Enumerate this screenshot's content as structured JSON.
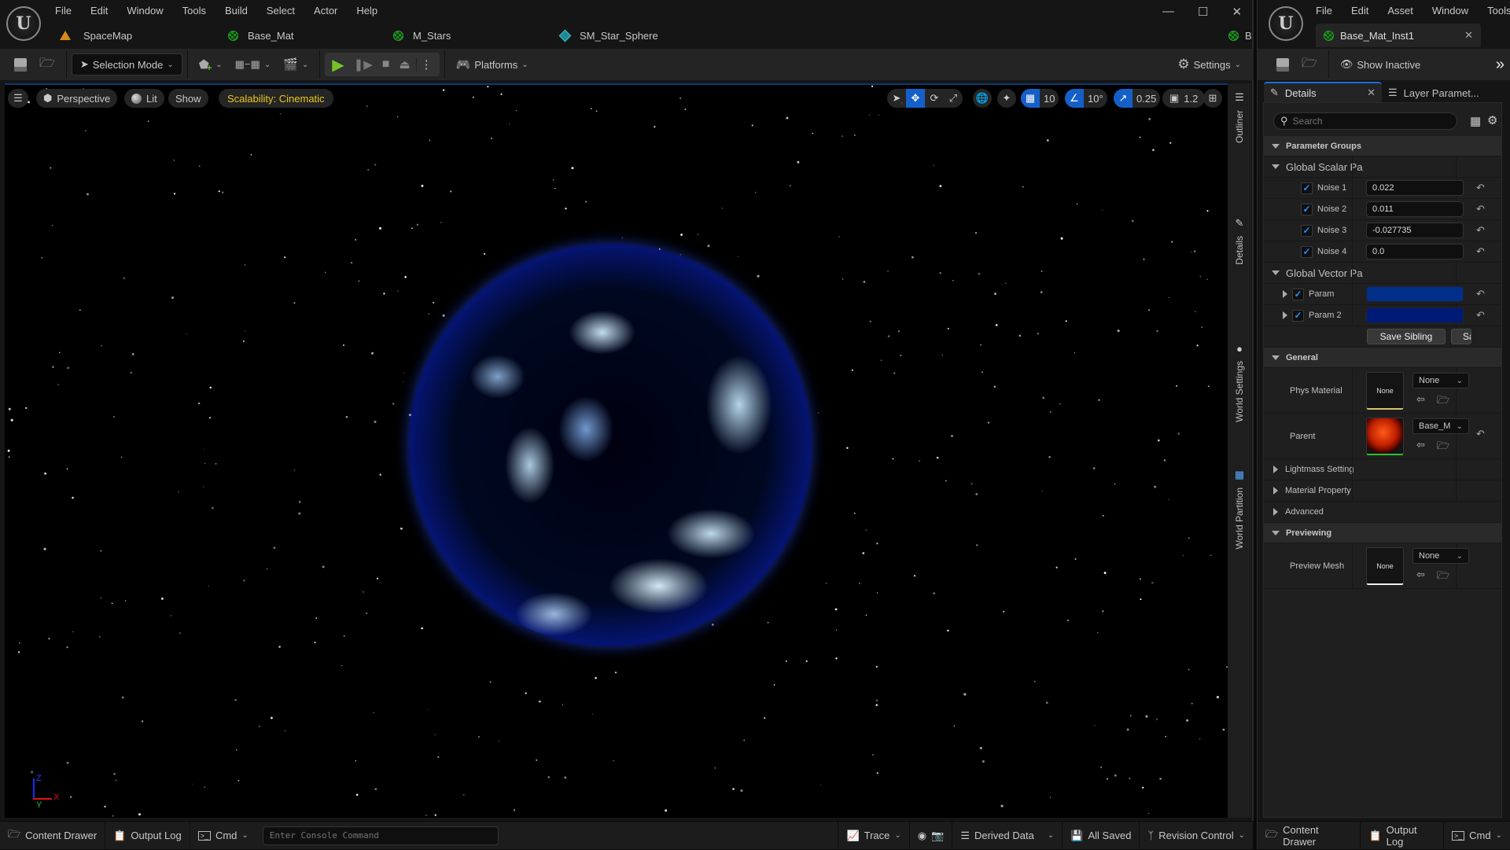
{
  "main_window": {
    "menu": [
      "File",
      "Edit",
      "Window",
      "Tools",
      "Build",
      "Select",
      "Actor",
      "Help"
    ],
    "tabs": [
      {
        "label": "SpaceMap",
        "icon": "level-icon"
      },
      {
        "label": "Base_Mat",
        "icon": "material-icon"
      },
      {
        "label": "M_Stars",
        "icon": "material-icon"
      },
      {
        "label": "SM_Star_Sphere",
        "icon": "static-mesh-icon"
      }
    ],
    "overflow_tab_label": "B",
    "toolbar": {
      "selection_mode": "Selection Mode",
      "platforms": "Platforms",
      "settings": "Settings"
    },
    "viewport": {
      "perspective": "Perspective",
      "lit": "Lit",
      "show": "Show",
      "scalability": "Scalability: Cinematic",
      "grid_snap": "10",
      "rotation_snap": "10°",
      "scale_snap": "0.25",
      "camera_speed": "1.2",
      "axis": {
        "x": "X",
        "y": "Y",
        "z": "Z"
      }
    },
    "side_tabs": [
      "Outliner",
      "Details",
      "World Settings",
      "World Partition"
    ],
    "status": {
      "content_drawer": "Content Drawer",
      "output_log": "Output Log",
      "cmd": "Cmd",
      "console_placeholder": "Enter Console Command",
      "trace": "Trace",
      "derived_data": "Derived Data",
      "all_saved": "All Saved",
      "revision_control": "Revision Control"
    }
  },
  "material_window": {
    "menu": [
      "File",
      "Edit",
      "Asset",
      "Window",
      "Tools"
    ],
    "tab_label": "Base_Mat_Inst1",
    "toolbar": {
      "show_inactive": "Show Inactive"
    },
    "panel_tabs": {
      "details": "Details",
      "layer_params": "Layer Paramet..."
    },
    "search_placeholder": "Search",
    "groups": {
      "parameter_groups": "Parameter Groups",
      "global_scalar": "Global Scalar Pa",
      "global_vector": "Global Vector Pa",
      "general": "General",
      "lightmass": "Lightmass Setting",
      "material_property": "Material Property",
      "advanced": "Advanced",
      "previewing": "Previewing"
    },
    "scalar_params": [
      {
        "name": "Noise 1",
        "value": "0.022",
        "enabled": true
      },
      {
        "name": "Noise 2",
        "value": "0.011",
        "enabled": true
      },
      {
        "name": "Noise 3",
        "value": "-0.027735",
        "enabled": true
      },
      {
        "name": "Noise 4",
        "value": "0.0",
        "enabled": true
      }
    ],
    "vector_params": [
      {
        "name": "Param",
        "color": "#00308a",
        "enabled": true
      },
      {
        "name": "Param 2",
        "color": "#001a78",
        "enabled": true
      }
    ],
    "save_sibling": "Save Sibling",
    "save_child_truncated": "Sa",
    "general": {
      "phys_material_label": "Phys Material",
      "phys_material_value": "None",
      "phys_material_thumb": "None",
      "parent_label": "Parent",
      "parent_value": "Base_M"
    },
    "previewing": {
      "preview_mesh_label": "Preview Mesh",
      "preview_mesh_value": "None",
      "preview_mesh_thumb": "None"
    },
    "status": {
      "content_drawer": "Content Drawer",
      "output_log": "Output Log",
      "cmd": "Cmd"
    }
  }
}
